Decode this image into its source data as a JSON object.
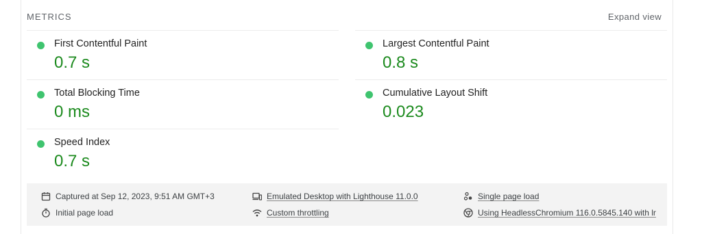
{
  "header": {
    "title": "METRICS",
    "expand_label": "Expand view"
  },
  "metrics": [
    {
      "label": "First Contentful Paint",
      "value": "0.7 s",
      "status_color": "#3fc46f"
    },
    {
      "label": "Largest Contentful Paint",
      "value": "0.8 s",
      "status_color": "#3fc46f"
    },
    {
      "label": "Total Blocking Time",
      "value": "0 ms",
      "status_color": "#3fc46f"
    },
    {
      "label": "Cumulative Layout Shift",
      "value": "0.023",
      "status_color": "#3fc46f"
    },
    {
      "label": "Speed Index",
      "value": "0.7 s",
      "status_color": "#3fc46f"
    }
  ],
  "runtime": {
    "captured": {
      "icon": "calendar-icon",
      "text": "Captured at Sep 12, 2023, 9:51 AM GMT+3"
    },
    "initial_load": {
      "icon": "stopwatch-icon",
      "text": "Initial page load"
    },
    "emulated": {
      "icon": "devices-icon",
      "text": "Emulated Desktop with Lighthouse 11.0.0"
    },
    "throttling": {
      "icon": "wifi-icon",
      "text": "Custom throttling"
    },
    "single_load": {
      "icon": "single-load-icon",
      "text": "Single page load"
    },
    "browser": {
      "icon": "chromium-icon",
      "text": "Using HeadlessChromium 116.0.5845.140 with lr"
    }
  },
  "colors": {
    "pass": "#3fc46f",
    "value_green": "#1b8a1d"
  }
}
